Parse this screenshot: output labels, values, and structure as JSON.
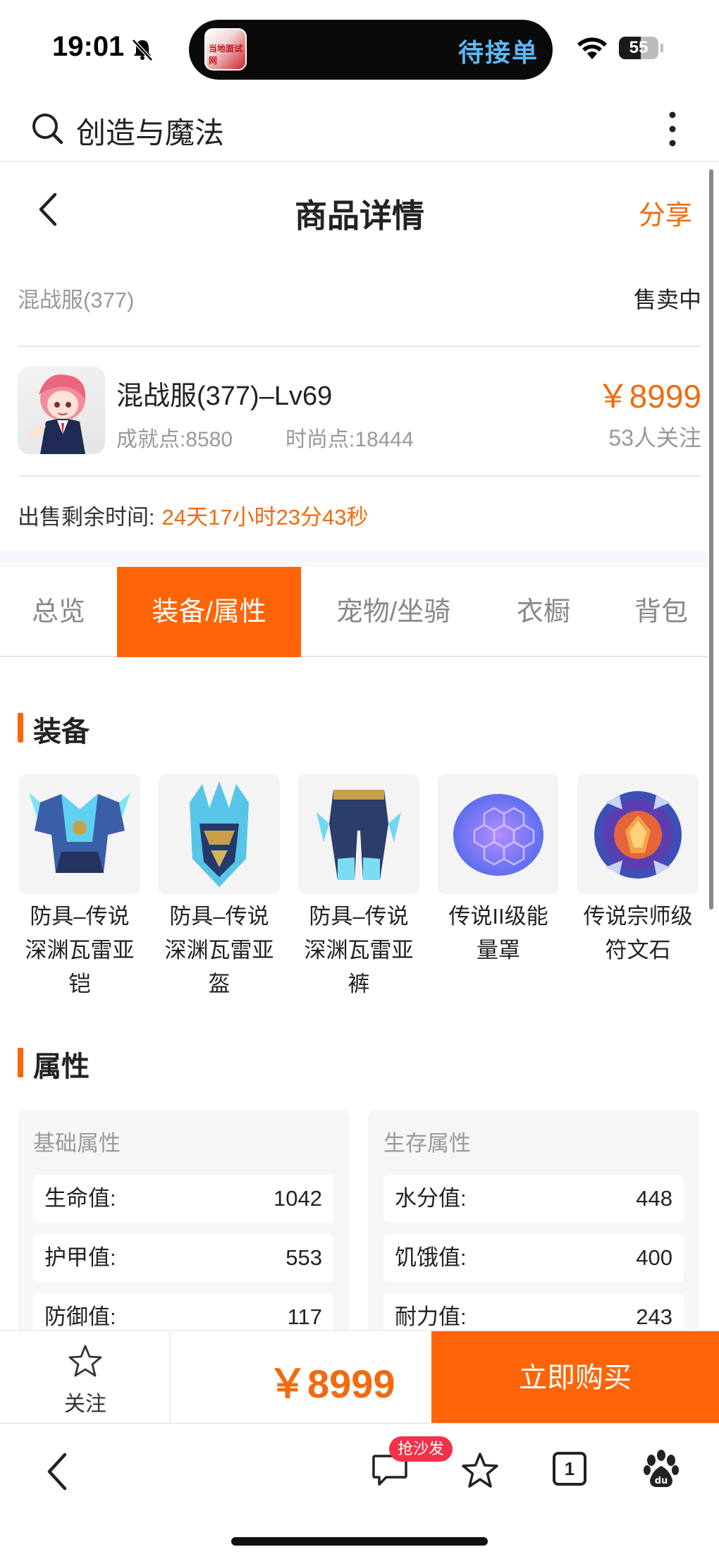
{
  "status_bar": {
    "time": "19:01",
    "live_activity_text": "待接单",
    "app_badge_text": "当地面试网",
    "battery": "55",
    "battery_level": 0.55
  },
  "search": {
    "query": "创造与魔法"
  },
  "header": {
    "title": "商品详情",
    "share": "分享"
  },
  "listing": {
    "server": "混战服(377)",
    "status": "售卖中",
    "name": "混战服(377)–Lv69",
    "achievement": "成就点:8580",
    "fashion": "时尚点:18444",
    "price": "￥8999",
    "followers": "53人关注",
    "remaining_label": "出售剩余时间:",
    "remaining_value": "24天17小时23分43秒"
  },
  "tabs": [
    {
      "label": "总览",
      "active": false
    },
    {
      "label": "装备/属性",
      "active": true
    },
    {
      "label": "宠物/坐骑",
      "active": false
    },
    {
      "label": "衣橱",
      "active": false
    },
    {
      "label": "背包",
      "active": false
    }
  ],
  "equipment": {
    "title": "装备",
    "items": [
      {
        "name": "防具–传说深渊瓦雷亚铠",
        "icon": "armor-chest-icon"
      },
      {
        "name": "防具–传说深渊瓦雷亚盔",
        "icon": "armor-helmet-icon"
      },
      {
        "name": "防具–传说深渊瓦雷亚裤",
        "icon": "armor-pants-icon"
      },
      {
        "name": "传说II级能量罩",
        "icon": "energy-shield-icon"
      },
      {
        "name": "传说宗师级符文石",
        "icon": "rune-stone-icon"
      }
    ]
  },
  "attributes": {
    "title": "属性",
    "groups": [
      {
        "title": "基础属性",
        "rows": [
          {
            "label": "生命值:",
            "value": "1042"
          },
          {
            "label": "护甲值:",
            "value": "553"
          },
          {
            "label": "防御值:",
            "value": "117"
          }
        ]
      },
      {
        "title": "生存属性",
        "rows": [
          {
            "label": "水分值:",
            "value": "448"
          },
          {
            "label": "饥饿值:",
            "value": "400"
          },
          {
            "label": "耐力值:",
            "value": "243"
          }
        ]
      }
    ]
  },
  "buy_bar": {
    "follow": "关注",
    "price": "￥8999",
    "buy": "立即购买"
  },
  "bottom_nav": {
    "badge": "抢沙发",
    "tab_count": "1"
  },
  "colors": {
    "accent": "#ff6408",
    "price": "#f26a0d",
    "island_text": "#5db8f5"
  }
}
